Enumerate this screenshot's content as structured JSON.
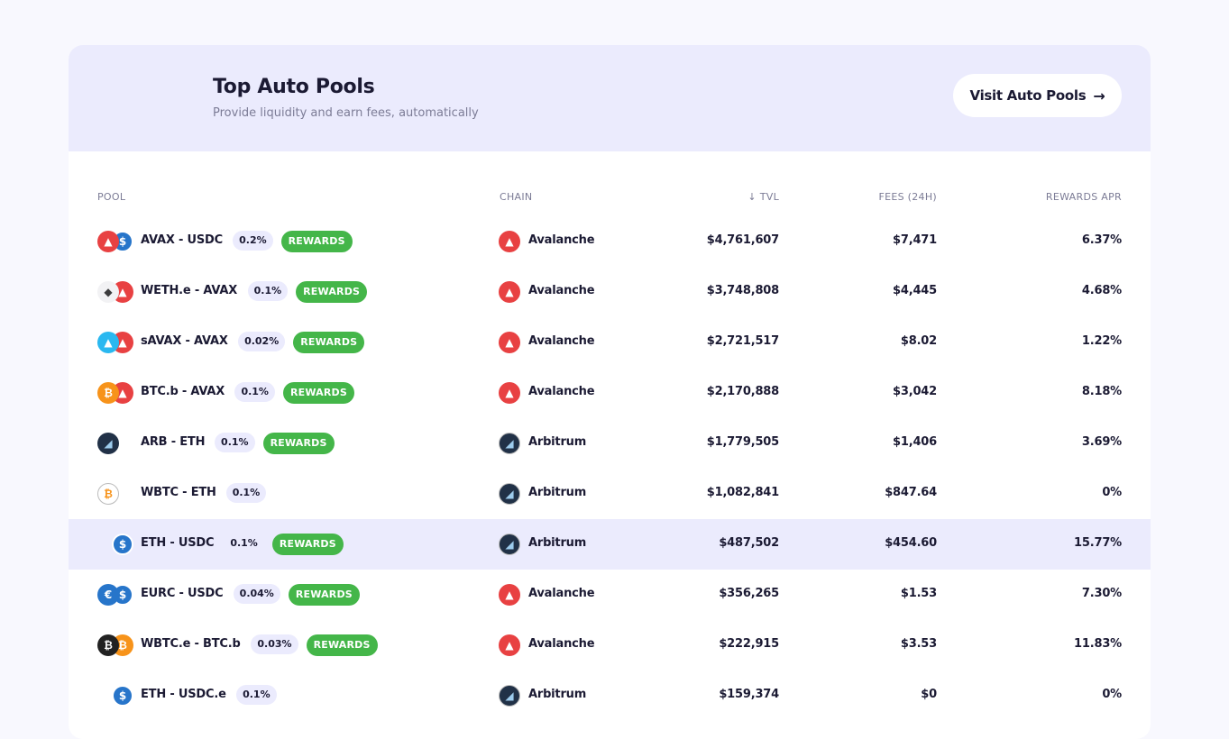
{
  "header": {
    "title": "Top Auto Pools",
    "subtitle": "Provide liquidity and earn fees, automatically",
    "visit_button": "Visit Auto Pools",
    "visit_arrow": "→"
  },
  "columns": {
    "pool": "POOL",
    "chain": "CHAIN",
    "tvl": "↓ TVL",
    "fees": "FEES (24H)",
    "apr": "REWARDS APR"
  },
  "rewards_label": "REWARDS",
  "colors": {
    "accent_bg": "#ebebfd",
    "rewards_green": "#44b649",
    "avax_red": "#e84142",
    "usdc_blue": "#2775ca",
    "btc_orange": "#f7931a"
  },
  "rows": [
    {
      "pair": "AVAX - USDC",
      "fee": "0.2%",
      "rewards": true,
      "chain": "Avalanche",
      "tvl": "$4,761,607",
      "fees": "$7,471",
      "apr": "6.37%",
      "icons": [
        "avax-icon",
        "usdc-icon"
      ]
    },
    {
      "pair": "WETH.e - AVAX",
      "fee": "0.1%",
      "rewards": true,
      "chain": "Avalanche",
      "tvl": "$3,748,808",
      "fees": "$4,445",
      "apr": "4.68%",
      "icons": [
        "eth-icon",
        "avax-icon"
      ]
    },
    {
      "pair": "sAVAX - AVAX",
      "fee": "0.02%",
      "rewards": true,
      "chain": "Avalanche",
      "tvl": "$2,721,517",
      "fees": "$8.02",
      "apr": "1.22%",
      "icons": [
        "savax-icon",
        "avax-icon"
      ]
    },
    {
      "pair": "BTC.b - AVAX",
      "fee": "0.1%",
      "rewards": true,
      "chain": "Avalanche",
      "tvl": "$2,170,888",
      "fees": "$3,042",
      "apr": "8.18%",
      "icons": [
        "btc-icon",
        "avax-icon"
      ]
    },
    {
      "pair": "ARB - ETH",
      "fee": "0.1%",
      "rewards": true,
      "chain": "Arbitrum",
      "tvl": "$1,779,505",
      "fees": "$1,406",
      "apr": "3.69%",
      "icons": [
        "arb-icon"
      ]
    },
    {
      "pair": "WBTC - ETH",
      "fee": "0.1%",
      "rewards": false,
      "chain": "Arbitrum",
      "tvl": "$1,082,841",
      "fees": "$847.64",
      "apr": "0%",
      "icons": [
        "wbtc-icon"
      ]
    },
    {
      "pair": "ETH - USDC",
      "fee": "0.1%",
      "rewards": true,
      "chain": "Arbitrum",
      "tvl": "$487,502",
      "fees": "$454.60",
      "apr": "15.77%",
      "icons": [
        "usdc-icon"
      ]
    },
    {
      "pair": "EURC - USDC",
      "fee": "0.04%",
      "rewards": true,
      "chain": "Avalanche",
      "tvl": "$356,265",
      "fees": "$1.53",
      "apr": "7.30%",
      "icons": [
        "eurc-icon",
        "usdc-icon"
      ]
    },
    {
      "pair": "WBTC.e - BTC.b",
      "fee": "0.03%",
      "rewards": true,
      "chain": "Avalanche",
      "tvl": "$222,915",
      "fees": "$3.53",
      "apr": "11.83%",
      "icons": [
        "wbtc-e-icon",
        "btc-icon"
      ]
    },
    {
      "pair": "ETH - USDC.e",
      "fee": "0.1%",
      "rewards": false,
      "chain": "Arbitrum",
      "tvl": "$159,374",
      "fees": "$0",
      "apr": "0%",
      "icons": [
        "usdc-icon"
      ]
    }
  ]
}
